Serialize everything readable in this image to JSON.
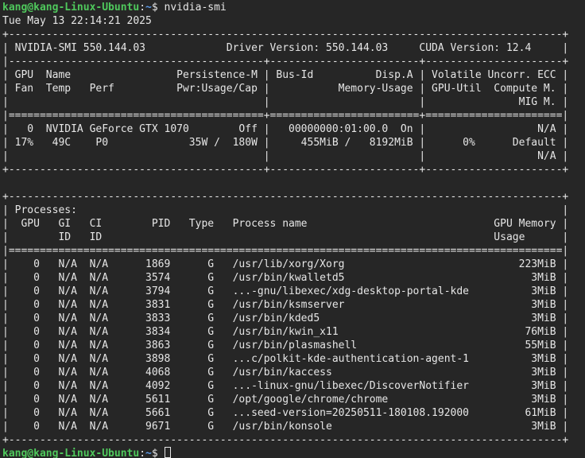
{
  "prompt": {
    "user_host": "kang@kang-Linux-Ubuntu",
    "separator": ":",
    "path": "~",
    "symbol": "$ "
  },
  "command": "nvidia-smi",
  "timestamp": "Tue May 13 22:14:21 2025",
  "output_lines": [
    "+-----------------------------------------------------------------------------------------+",
    "| NVIDIA-SMI 550.144.03             Driver Version: 550.144.03     CUDA Version: 12.4     |",
    "|-----------------------------------------+------------------------+----------------------+",
    "| GPU  Name                 Persistence-M | Bus-Id          Disp.A | Volatile Uncorr. ECC |",
    "| Fan  Temp   Perf          Pwr:Usage/Cap |           Memory-Usage | GPU-Util  Compute M. |",
    "|                                         |                        |               MIG M. |",
    "|=========================================+========================+======================|",
    "|   0  NVIDIA GeForce GTX 1070        Off |   00000000:01:00.0  On |                  N/A |",
    "| 17%   49C    P0             35W /  180W |     455MiB /   8192MiB |      0%      Default |",
    "|                                         |                        |                  N/A |",
    "+-----------------------------------------+------------------------+----------------------+",
    "",
    "+-----------------------------------------------------------------------------------------+",
    "| Processes:                                                                              |",
    "|  GPU   GI   CI        PID   Type   Process name                              GPU Memory |",
    "|        ID   ID                                                               Usage      |",
    "|=========================================================================================|",
    "|    0   N/A  N/A      1869      G   /usr/lib/xorg/Xorg                            223MiB |",
    "|    0   N/A  N/A      3574      G   /usr/bin/kwalletd5                              3MiB |",
    "|    0   N/A  N/A      3794      G   ...-gnu/libexec/xdg-desktop-portal-kde          3MiB |",
    "|    0   N/A  N/A      3831      G   /usr/bin/ksmserver                              3MiB |",
    "|    0   N/A  N/A      3833      G   /usr/bin/kded5                                  3MiB |",
    "|    0   N/A  N/A      3834      G   /usr/bin/kwin_x11                              76MiB |",
    "|    0   N/A  N/A      3863      G   /usr/bin/plasmashell                           55MiB |",
    "|    0   N/A  N/A      3898      G   ...c/polkit-kde-authentication-agent-1          3MiB |",
    "|    0   N/A  N/A      4068      G   /usr/bin/kaccess                                3MiB |",
    "|    0   N/A  N/A      4092      G   ...-linux-gnu/libexec/DiscoverNotifier          3MiB |",
    "|    0   N/A  N/A      5611      G   /opt/google/chrome/chrome                       3MiB |",
    "|    0   N/A  N/A      5661      G   ...seed-version=20250511-180108.192000         61MiB |",
    "|    0   N/A  N/A      9671      G   /usr/bin/konsole                                3MiB |",
    "+-----------------------------------------------------------------------------------------+"
  ]
}
